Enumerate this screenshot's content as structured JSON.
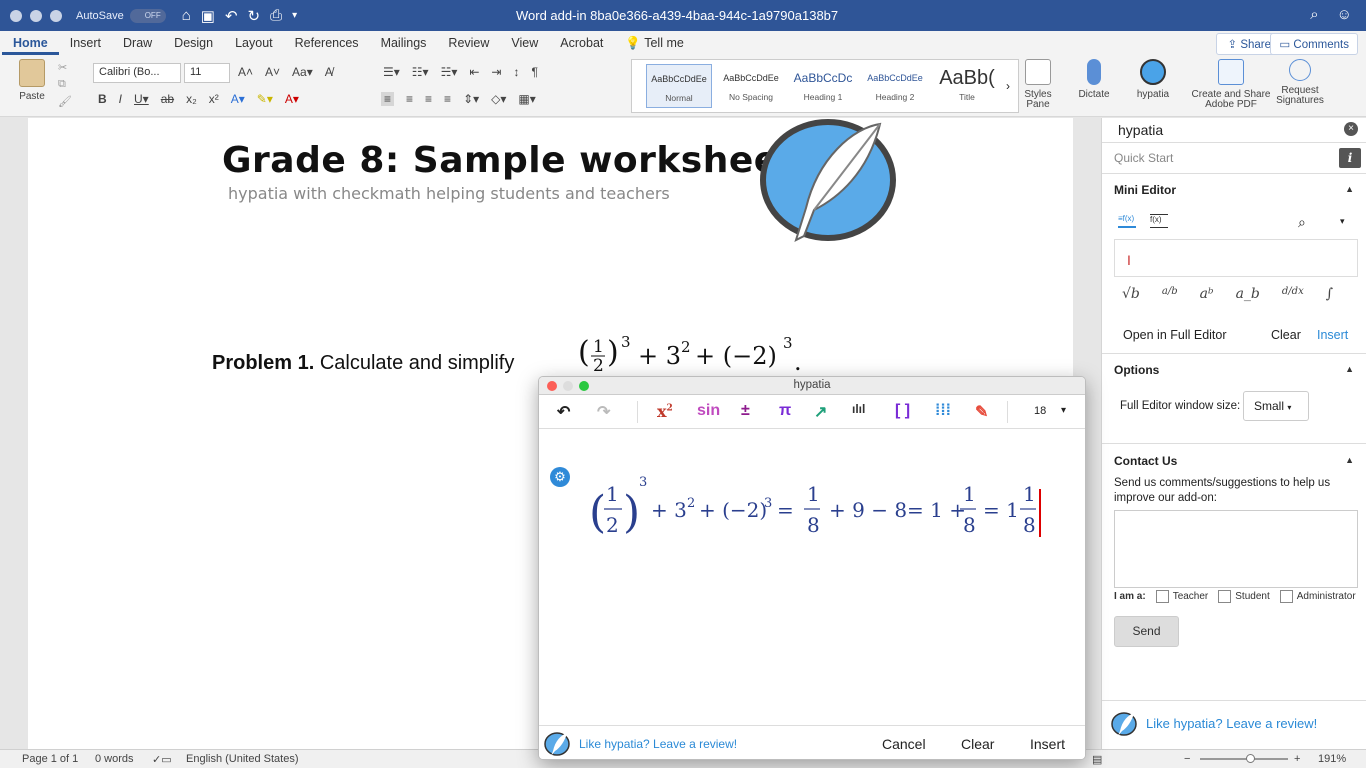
{
  "window": {
    "autosave_label": "AutoSave",
    "autosave_state": "OFF",
    "title": "Word add-in 8ba0e366-a439-4baa-944c-1a9790a138b7"
  },
  "ribbon": {
    "tabs": [
      "Home",
      "Insert",
      "Draw",
      "Design",
      "Layout",
      "References",
      "Mailings",
      "Review",
      "View",
      "Acrobat",
      "Tell me"
    ],
    "share_label": "Share",
    "comments_label": "Comments",
    "paste_label": "Paste",
    "font_name": "Calibri (Bo...",
    "font_size": "11",
    "styles": [
      {
        "sample": "AaBbCcDdEe",
        "name": "Normal"
      },
      {
        "sample": "AaBbCcDdEe",
        "name": "No Spacing"
      },
      {
        "sample": "AaBbCcDc",
        "name": "Heading 1"
      },
      {
        "sample": "AaBbCcDdEe",
        "name": "Heading 2"
      },
      {
        "sample": "AaBb(",
        "name": "Title"
      }
    ],
    "styles_pane_label_1": "Styles",
    "styles_pane_label_2": "Pane",
    "dictate_label": "Dictate",
    "hypatia_label": "hypatia",
    "adobe_label_1": "Create and Share",
    "adobe_label_2": "Adobe PDF",
    "sign_label_1": "Request",
    "sign_label_2": "Signatures"
  },
  "document": {
    "title": "Grade 8: Sample worksheet",
    "subtitle": "hypatia with checkmath helping students and teachers",
    "problem_label": "Problem 1.",
    "problem_text": "Calculate and simplify"
  },
  "status": {
    "page": "Page 1 of 1",
    "words": "0 words",
    "language": "English (United States)",
    "zoom": "191%"
  },
  "pane": {
    "title": "hypatia",
    "quick_start": "Quick Start",
    "mini_editor": "Mini Editor",
    "open_full": "Open in Full Editor",
    "clear": "Clear",
    "insert": "Insert",
    "options": "Options",
    "window_size_label": "Full Editor window size:",
    "window_size_value": "Small",
    "contact_us": "Contact Us",
    "contact_text": "Send us comments/suggestions to help us improve our add-on:",
    "iam_label": "I am a:",
    "roles": [
      "Teacher",
      "Student",
      "Administrator"
    ],
    "send": "Send",
    "review": "Like hypatia? Leave a review!"
  },
  "editor": {
    "title": "hypatia",
    "font_size": "18",
    "review": "Like hypatia? Leave a review!",
    "cancel": "Cancel",
    "clear": "Clear",
    "insert": "Insert"
  }
}
